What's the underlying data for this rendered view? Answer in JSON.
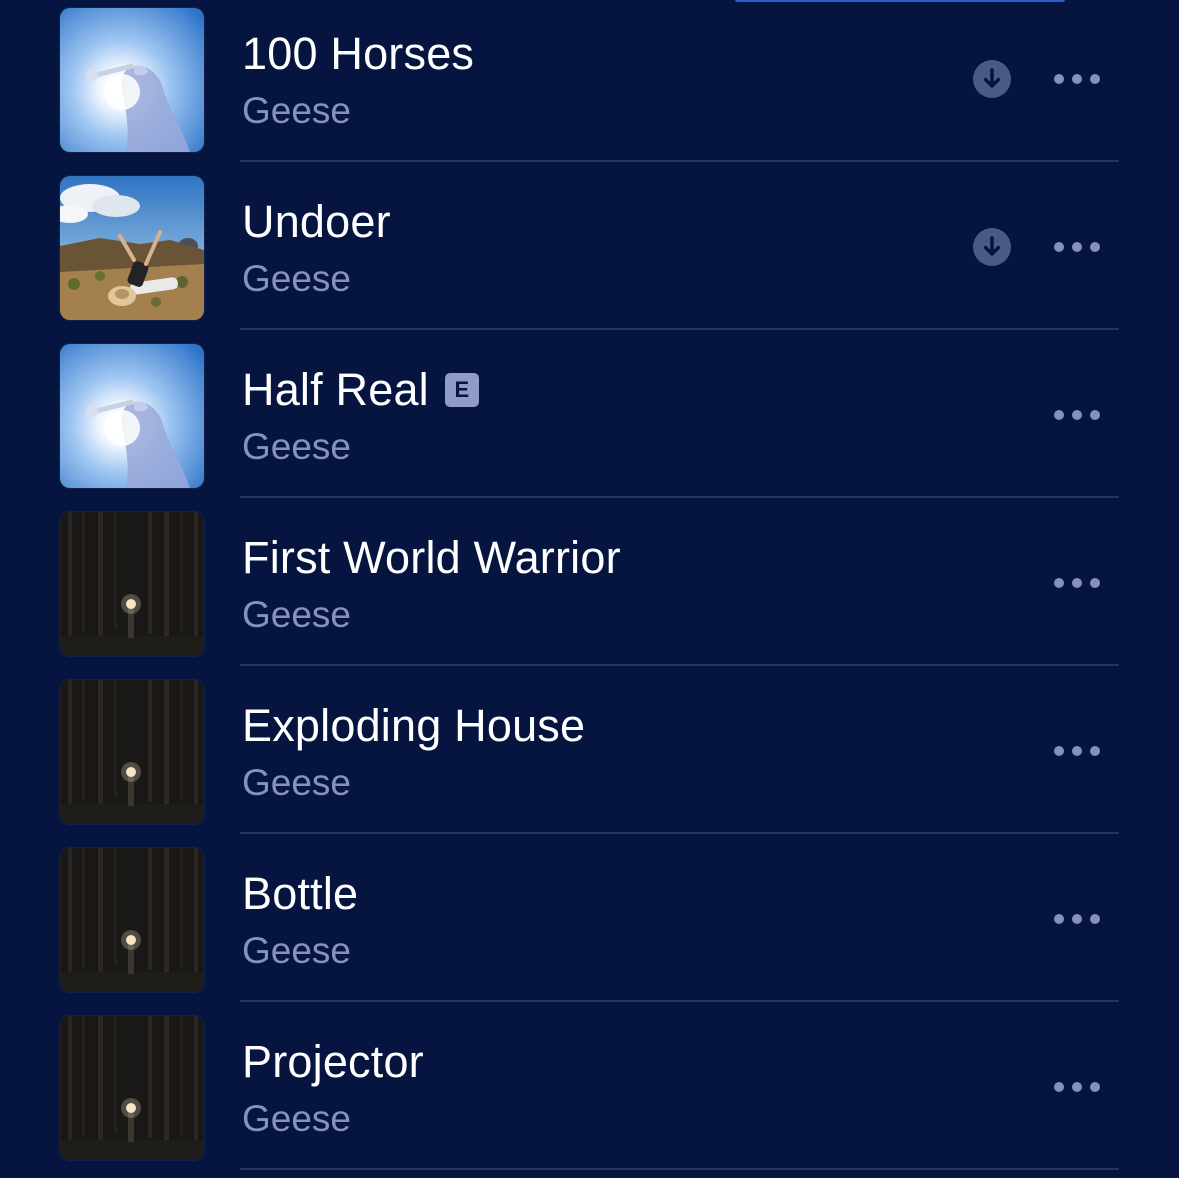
{
  "colors": {
    "background": "#061540",
    "title": "#ffffff",
    "secondary": "#8592ba",
    "separator": "#27355e",
    "explicit_badge": "#8e9cc7"
  },
  "songs": [
    {
      "title": "100 Horses",
      "artist": "Geese",
      "explicit": false,
      "downloadable": true,
      "artwork": "trumpet-cover-icon",
      "more": "more-icon"
    },
    {
      "title": "Undoer",
      "artist": "Geese",
      "explicit": false,
      "downloadable": true,
      "artwork": "desert-figure-cover-icon",
      "more": "more-icon"
    },
    {
      "title": "Half Real",
      "artist": "Geese",
      "explicit": true,
      "explicit_label": "E",
      "downloadable": false,
      "artwork": "trumpet-cover-icon",
      "more": "more-icon"
    },
    {
      "title": "First World Warrior",
      "artist": "Geese",
      "explicit": false,
      "downloadable": false,
      "artwork": "dark-forest-cover-icon",
      "more": "more-icon"
    },
    {
      "title": "Exploding House",
      "artist": "Geese",
      "explicit": false,
      "downloadable": false,
      "artwork": "dark-forest-cover-icon",
      "more": "more-icon"
    },
    {
      "title": "Bottle",
      "artist": "Geese",
      "explicit": false,
      "downloadable": false,
      "artwork": "dark-forest-cover-icon",
      "more": "more-icon"
    },
    {
      "title": "Projector",
      "artist": "Geese",
      "explicit": false,
      "downloadable": false,
      "artwork": "dark-forest-cover-icon",
      "more": "more-icon"
    }
  ]
}
